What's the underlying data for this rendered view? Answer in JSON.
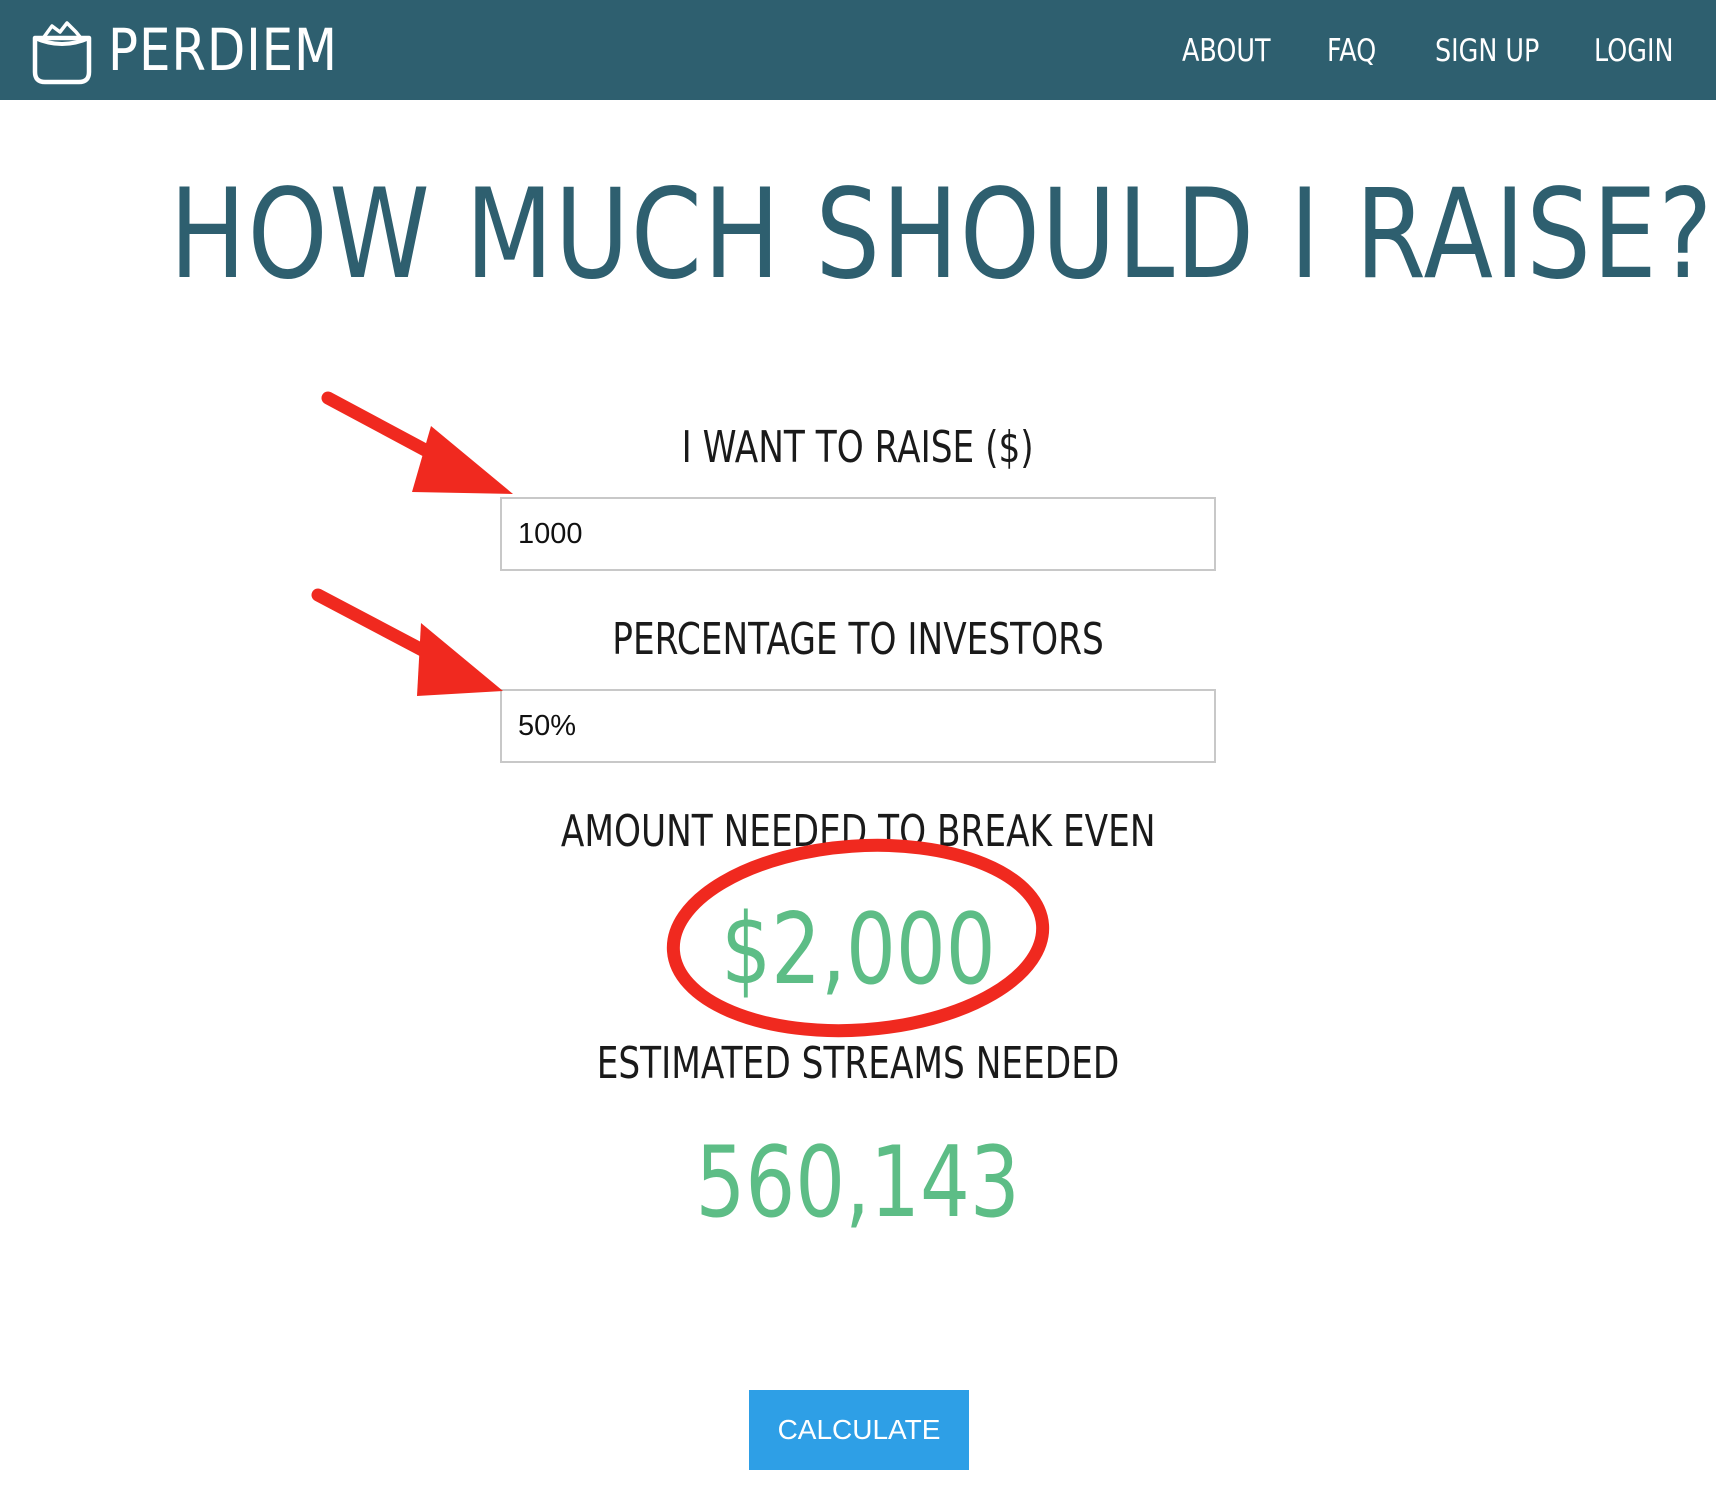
{
  "header": {
    "brand_name": "PERDIEM",
    "brand_icon": "pocket-logo-icon",
    "background_color": "#2e5f6f",
    "nav": [
      {
        "label": "ABOUT"
      },
      {
        "label": "FAQ"
      },
      {
        "label": "SIGN UP"
      },
      {
        "label": "LOGIN"
      }
    ]
  },
  "main": {
    "title": "HOW MUCH SHOULD I RAISE?",
    "title_color": "#2e5f6f",
    "raise_field": {
      "label": "I WANT TO RAISE ($)",
      "value": "1000"
    },
    "percentage_field": {
      "label": "PERCENTAGE TO INVESTORS",
      "value": "50%"
    },
    "break_even": {
      "label": "AMOUNT NEEDED TO BREAK EVEN",
      "value": "$2,000"
    },
    "streams": {
      "label": "ESTIMATED STREAMS NEEDED",
      "value": "560,143"
    },
    "result_color": "#5dbd86",
    "calculate_button": {
      "label": "CALCULATE",
      "color": "#2e9fe6"
    }
  },
  "annotations": {
    "color": "#f0291f",
    "items": [
      {
        "type": "arrow",
        "points_to": "raise-input"
      },
      {
        "type": "arrow",
        "points_to": "percentage-input"
      },
      {
        "type": "circle",
        "highlights": "break-even-value"
      }
    ]
  }
}
